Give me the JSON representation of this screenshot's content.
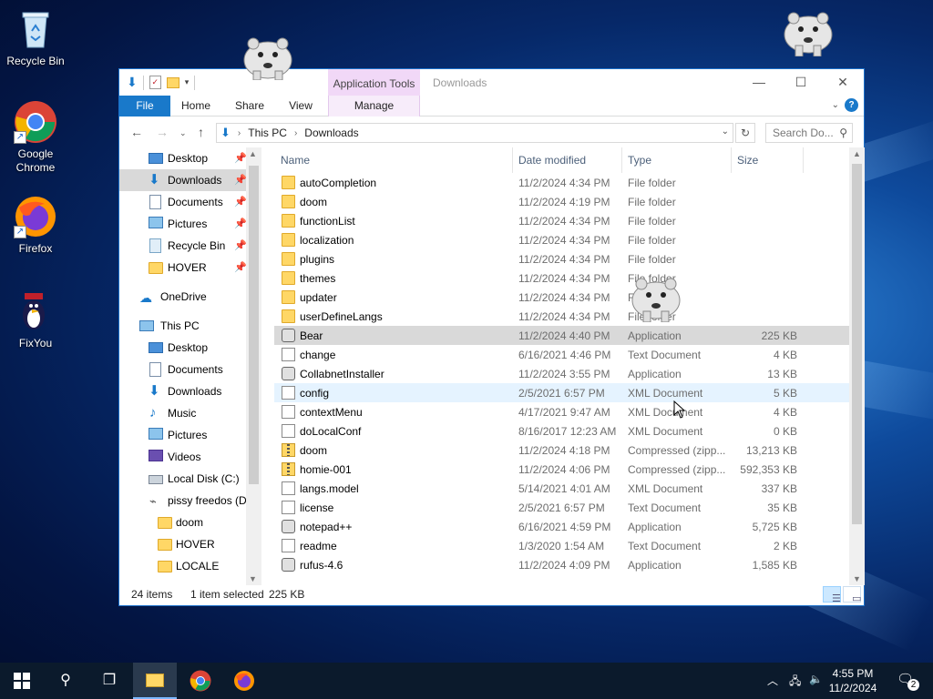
{
  "desktop": {
    "icons": [
      {
        "name": "recycle-bin",
        "label": "Recycle Bin"
      },
      {
        "name": "google-chrome",
        "label": "Google Chrome"
      },
      {
        "name": "firefox",
        "label": "Firefox"
      },
      {
        "name": "fixyou",
        "label": "FixYou"
      }
    ]
  },
  "window": {
    "title": "Downloads",
    "context_tab_group": "Application Tools",
    "tabs": [
      "File",
      "Home",
      "Share",
      "View",
      "Manage"
    ],
    "help_label": "?",
    "address": {
      "segments": [
        "This PC",
        "Downloads"
      ]
    },
    "search": {
      "placeholder": "Search Do..."
    },
    "nav_pane": {
      "quick_access": [
        {
          "label": "Desktop",
          "icon": "desktop-icon",
          "pinned": true
        },
        {
          "label": "Downloads",
          "icon": "downloads-icon",
          "pinned": true,
          "selected": true
        },
        {
          "label": "Documents",
          "icon": "documents-icon",
          "pinned": true
        },
        {
          "label": "Pictures",
          "icon": "pictures-icon",
          "pinned": true
        },
        {
          "label": "Recycle Bin",
          "icon": "recycle-bin-icon",
          "pinned": true
        },
        {
          "label": "HOVER",
          "icon": "folder-icon",
          "pinned": true
        }
      ],
      "onedrive": "OneDrive",
      "this_pc": "This PC",
      "this_pc_items": [
        {
          "label": "Desktop",
          "icon": "desktop-icon"
        },
        {
          "label": "Documents",
          "icon": "documents-icon"
        },
        {
          "label": "Downloads",
          "icon": "downloads-icon"
        },
        {
          "label": "Music",
          "icon": "music-icon"
        },
        {
          "label": "Pictures",
          "icon": "pictures-icon"
        },
        {
          "label": "Videos",
          "icon": "videos-icon"
        },
        {
          "label": "Local Disk (C:)",
          "icon": "drive-icon"
        },
        {
          "label": "pissy freedos (D:",
          "icon": "usb-drive-icon"
        }
      ],
      "drive_d_items": [
        {
          "label": "doom"
        },
        {
          "label": "HOVER"
        },
        {
          "label": "LOCALE"
        }
      ]
    },
    "columns": {
      "name": "Name",
      "date": "Date modified",
      "type": "Type",
      "size": "Size"
    },
    "files": [
      {
        "name": "autoCompletion",
        "date": "11/2/2024 4:34 PM",
        "type": "File folder",
        "size": "",
        "kind": "folder"
      },
      {
        "name": "doom",
        "date": "11/2/2024 4:19 PM",
        "type": "File folder",
        "size": "",
        "kind": "folder"
      },
      {
        "name": "functionList",
        "date": "11/2/2024 4:34 PM",
        "type": "File folder",
        "size": "",
        "kind": "folder"
      },
      {
        "name": "localization",
        "date": "11/2/2024 4:34 PM",
        "type": "File folder",
        "size": "",
        "kind": "folder"
      },
      {
        "name": "plugins",
        "date": "11/2/2024 4:34 PM",
        "type": "File folder",
        "size": "",
        "kind": "folder"
      },
      {
        "name": "themes",
        "date": "11/2/2024 4:34 PM",
        "type": "File folder",
        "size": "",
        "kind": "folder"
      },
      {
        "name": "updater",
        "date": "11/2/2024 4:34 PM",
        "type": "File folder",
        "size": "",
        "kind": "folder"
      },
      {
        "name": "userDefineLangs",
        "date": "11/2/2024 4:34 PM",
        "type": "File folder",
        "size": "",
        "kind": "folder"
      },
      {
        "name": "Bear",
        "date": "11/2/2024 4:40 PM",
        "type": "Application",
        "size": "225 KB",
        "kind": "app",
        "selected": true
      },
      {
        "name": "change",
        "date": "6/16/2021 4:46 PM",
        "type": "Text Document",
        "size": "4 KB",
        "kind": "doc"
      },
      {
        "name": "CollabnetInstaller",
        "date": "11/2/2024 3:55 PM",
        "type": "Application",
        "size": "13 KB",
        "kind": "app"
      },
      {
        "name": "config",
        "date": "2/5/2021 6:57 PM",
        "type": "XML Document",
        "size": "5 KB",
        "kind": "doc",
        "hover": true
      },
      {
        "name": "contextMenu",
        "date": "4/17/2021 9:47 AM",
        "type": "XML Document",
        "size": "4 KB",
        "kind": "doc"
      },
      {
        "name": "doLocalConf",
        "date": "8/16/2017 12:23 AM",
        "type": "XML Document",
        "size": "0 KB",
        "kind": "doc"
      },
      {
        "name": "doom",
        "date": "11/2/2024 4:18 PM",
        "type": "Compressed (zipp...",
        "size": "13,213 KB",
        "kind": "zip"
      },
      {
        "name": "homie-001",
        "date": "11/2/2024 4:06 PM",
        "type": "Compressed (zipp...",
        "size": "592,353 KB",
        "kind": "zip"
      },
      {
        "name": "langs.model",
        "date": "5/14/2021 4:01 AM",
        "type": "XML Document",
        "size": "337 KB",
        "kind": "doc"
      },
      {
        "name": "license",
        "date": "2/5/2021 6:57 PM",
        "type": "Text Document",
        "size": "35 KB",
        "kind": "doc"
      },
      {
        "name": "notepad++",
        "date": "6/16/2021 4:59 PM",
        "type": "Application",
        "size": "5,725 KB",
        "kind": "app"
      },
      {
        "name": "readme",
        "date": "1/3/2020 1:54 AM",
        "type": "Text Document",
        "size": "2 KB",
        "kind": "doc"
      },
      {
        "name": "rufus-4.6",
        "date": "11/2/2024 4:09 PM",
        "type": "Application",
        "size": "1,585 KB",
        "kind": "app"
      }
    ],
    "status": {
      "item_count": "24 items",
      "selection": "1 item selected",
      "selection_size": "225 KB"
    }
  },
  "taskbar": {
    "time": "4:55 PM",
    "date": "11/2/2024",
    "notification_count": "2"
  }
}
